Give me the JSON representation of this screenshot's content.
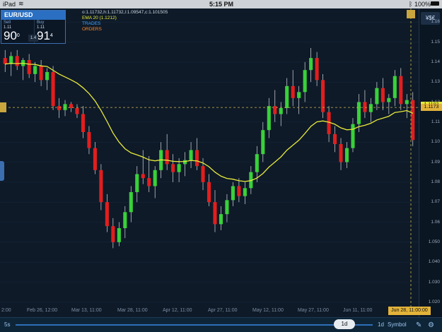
{
  "status_bar": {
    "device": "iPad",
    "time": "5:15 PM",
    "battery": "100%"
  },
  "ticket": {
    "pair": "EUR/USD",
    "sell_label": "Sell",
    "sell_prefix": "1.11",
    "sell_big": "90",
    "sell_sup": "0",
    "buy_label": "Buy",
    "buy_prefix": "1.11",
    "buy_big": "91",
    "buy_sup": "4",
    "spread": "1.4"
  },
  "info": {
    "ohlc": "o:1.11732,h:1.11732,l:1.09547,c:1.101505",
    "ema": "EMA 20 (1.1212)",
    "trades": "TRADES",
    "orders": "ORDERS"
  },
  "price_panel": {
    "currency_button": "¥$€",
    "ema_price": "1.1183",
    "current_price": "1.1173",
    "y_labels": [
      "1.16",
      "1.15",
      "1.14",
      "1.13",
      "1.12",
      "1.11",
      "1.10",
      "1.09",
      "1.08",
      "1.07",
      "1.06",
      "1.050",
      "1.040",
      "1.030",
      "1.020"
    ]
  },
  "x_axis": {
    "labels": [
      "2:00",
      "Feb 26, 12:00",
      "Mar 13, 11:00",
      "Mar 28, 11:00",
      "Apr 12, 11:00",
      "Apr 27, 11:00",
      "May 12, 11:00",
      "May 27, 11:00",
      "Jun 11, 11:00"
    ],
    "current_date": "Jun 28, 11:00:00"
  },
  "bottom_bar": {
    "left": "5s",
    "knob": "1d",
    "period": "1d",
    "symbol": "Symbol"
  },
  "colors": {
    "up": "#39d13a",
    "down": "#e21e1e",
    "ema": "#e8ea3a",
    "accent": "#2a6fc2",
    "gold": "#e2b33a"
  },
  "chart_data": {
    "type": "candlestick",
    "ylim": [
      1.015,
      1.165
    ],
    "ema_label": "EMA 20",
    "candles": [
      {
        "o": 1.142,
        "h": 1.146,
        "l": 1.135,
        "c": 1.139
      },
      {
        "o": 1.139,
        "h": 1.145,
        "l": 1.133,
        "c": 1.143
      },
      {
        "o": 1.143,
        "h": 1.146,
        "l": 1.136,
        "c": 1.138
      },
      {
        "o": 1.138,
        "h": 1.142,
        "l": 1.131,
        "c": 1.141
      },
      {
        "o": 1.141,
        "h": 1.144,
        "l": 1.132,
        "c": 1.134
      },
      {
        "o": 1.134,
        "h": 1.14,
        "l": 1.13,
        "c": 1.138
      },
      {
        "o": 1.138,
        "h": 1.141,
        "l": 1.128,
        "c": 1.131
      },
      {
        "o": 1.131,
        "h": 1.137,
        "l": 1.126,
        "c": 1.135
      },
      {
        "o": 1.135,
        "h": 1.138,
        "l": 1.116,
        "c": 1.118
      },
      {
        "o": 1.118,
        "h": 1.122,
        "l": 1.112,
        "c": 1.116
      },
      {
        "o": 1.116,
        "h": 1.121,
        "l": 1.113,
        "c": 1.119
      },
      {
        "o": 1.119,
        "h": 1.12,
        "l": 1.115,
        "c": 1.117
      },
      {
        "o": 1.117,
        "h": 1.119,
        "l": 1.112,
        "c": 1.114
      },
      {
        "o": 1.114,
        "h": 1.118,
        "l": 1.102,
        "c": 1.105
      },
      {
        "o": 1.105,
        "h": 1.108,
        "l": 1.094,
        "c": 1.097
      },
      {
        "o": 1.097,
        "h": 1.1,
        "l": 1.084,
        "c": 1.086
      },
      {
        "o": 1.086,
        "h": 1.089,
        "l": 1.066,
        "c": 1.07
      },
      {
        "o": 1.07,
        "h": 1.074,
        "l": 1.055,
        "c": 1.058
      },
      {
        "o": 1.058,
        "h": 1.062,
        "l": 1.047,
        "c": 1.05
      },
      {
        "o": 1.05,
        "h": 1.06,
        "l": 1.048,
        "c": 1.057
      },
      {
        "o": 1.057,
        "h": 1.068,
        "l": 1.052,
        "c": 1.065
      },
      {
        "o": 1.065,
        "h": 1.078,
        "l": 1.06,
        "c": 1.075
      },
      {
        "o": 1.075,
        "h": 1.088,
        "l": 1.07,
        "c": 1.084
      },
      {
        "o": 1.084,
        "h": 1.096,
        "l": 1.079,
        "c": 1.082
      },
      {
        "o": 1.082,
        "h": 1.093,
        "l": 1.075,
        "c": 1.078
      },
      {
        "o": 1.078,
        "h": 1.088,
        "l": 1.072,
        "c": 1.086
      },
      {
        "o": 1.086,
        "h": 1.1,
        "l": 1.082,
        "c": 1.096
      },
      {
        "o": 1.096,
        "h": 1.104,
        "l": 1.086,
        "c": 1.089
      },
      {
        "o": 1.089,
        "h": 1.094,
        "l": 1.08,
        "c": 1.085
      },
      {
        "o": 1.085,
        "h": 1.092,
        "l": 1.08,
        "c": 1.089
      },
      {
        "o": 1.089,
        "h": 1.095,
        "l": 1.083,
        "c": 1.091
      },
      {
        "o": 1.091,
        "h": 1.1,
        "l": 1.087,
        "c": 1.096
      },
      {
        "o": 1.096,
        "h": 1.102,
        "l": 1.086,
        "c": 1.088
      },
      {
        "o": 1.088,
        "h": 1.092,
        "l": 1.076,
        "c": 1.08
      },
      {
        "o": 1.08,
        "h": 1.084,
        "l": 1.068,
        "c": 1.07
      },
      {
        "o": 1.07,
        "h": 1.076,
        "l": 1.055,
        "c": 1.059
      },
      {
        "o": 1.059,
        "h": 1.068,
        "l": 1.056,
        "c": 1.064
      },
      {
        "o": 1.064,
        "h": 1.074,
        "l": 1.06,
        "c": 1.071
      },
      {
        "o": 1.071,
        "h": 1.08,
        "l": 1.068,
        "c": 1.078
      },
      {
        "o": 1.078,
        "h": 1.082,
        "l": 1.07,
        "c": 1.073
      },
      {
        "o": 1.073,
        "h": 1.08,
        "l": 1.069,
        "c": 1.077
      },
      {
        "o": 1.077,
        "h": 1.088,
        "l": 1.074,
        "c": 1.085
      },
      {
        "o": 1.085,
        "h": 1.098,
        "l": 1.08,
        "c": 1.094
      },
      {
        "o": 1.094,
        "h": 1.11,
        "l": 1.09,
        "c": 1.106
      },
      {
        "o": 1.106,
        "h": 1.122,
        "l": 1.102,
        "c": 1.118
      },
      {
        "o": 1.118,
        "h": 1.126,
        "l": 1.11,
        "c": 1.114
      },
      {
        "o": 1.114,
        "h": 1.12,
        "l": 1.108,
        "c": 1.117
      },
      {
        "o": 1.117,
        "h": 1.132,
        "l": 1.114,
        "c": 1.128
      },
      {
        "o": 1.128,
        "h": 1.136,
        "l": 1.118,
        "c": 1.122
      },
      {
        "o": 1.122,
        "h": 1.128,
        "l": 1.114,
        "c": 1.125
      },
      {
        "o": 1.125,
        "h": 1.14,
        "l": 1.12,
        "c": 1.136
      },
      {
        "o": 1.136,
        "h": 1.147,
        "l": 1.13,
        "c": 1.142
      },
      {
        "o": 1.142,
        "h": 1.145,
        "l": 1.128,
        "c": 1.131
      },
      {
        "o": 1.131,
        "h": 1.134,
        "l": 1.112,
        "c": 1.115
      },
      {
        "o": 1.115,
        "h": 1.118,
        "l": 1.1,
        "c": 1.104
      },
      {
        "o": 1.104,
        "h": 1.108,
        "l": 1.095,
        "c": 1.099
      },
      {
        "o": 1.099,
        "h": 1.102,
        "l": 1.086,
        "c": 1.09
      },
      {
        "o": 1.09,
        "h": 1.1,
        "l": 1.087,
        "c": 1.097
      },
      {
        "o": 1.097,
        "h": 1.112,
        "l": 1.095,
        "c": 1.109
      },
      {
        "o": 1.109,
        "h": 1.124,
        "l": 1.105,
        "c": 1.12
      },
      {
        "o": 1.12,
        "h": 1.126,
        "l": 1.112,
        "c": 1.115
      },
      {
        "o": 1.115,
        "h": 1.122,
        "l": 1.11,
        "c": 1.119
      },
      {
        "o": 1.119,
        "h": 1.13,
        "l": 1.116,
        "c": 1.127
      },
      {
        "o": 1.127,
        "h": 1.132,
        "l": 1.116,
        "c": 1.12
      },
      {
        "o": 1.12,
        "h": 1.124,
        "l": 1.114,
        "c": 1.122
      },
      {
        "o": 1.122,
        "h": 1.136,
        "l": 1.118,
        "c": 1.133
      },
      {
        "o": 1.133,
        "h": 1.137,
        "l": 1.116,
        "c": 1.119
      },
      {
        "o": 1.119,
        "h": 1.124,
        "l": 1.112,
        "c": 1.121
      },
      {
        "o": 1.121,
        "h": 1.125,
        "l": 1.098,
        "c": 1.101
      }
    ]
  }
}
